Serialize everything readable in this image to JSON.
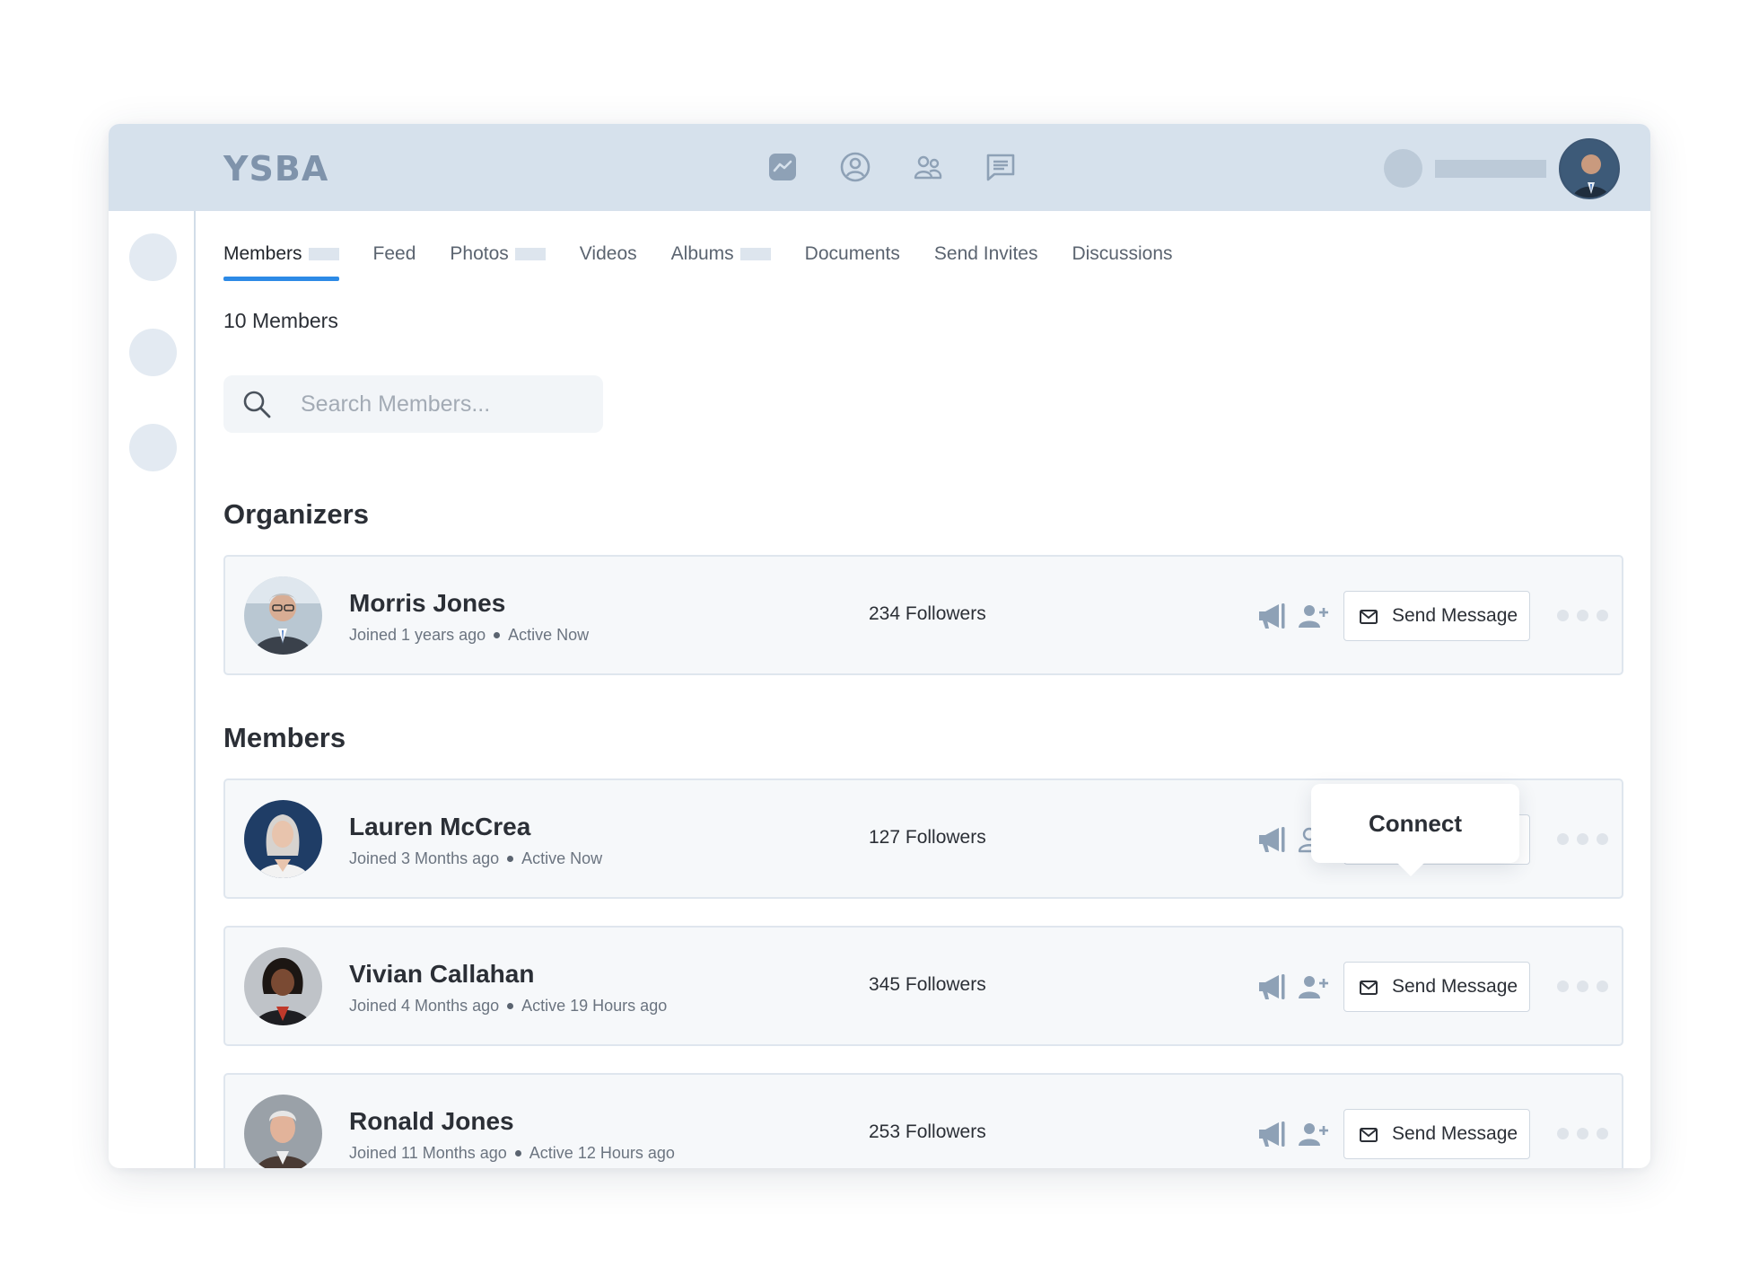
{
  "header": {
    "logo": "YSBA",
    "nav_icons": [
      "activity-icon",
      "profile-icon",
      "groups-icon",
      "messages-icon"
    ]
  },
  "tabs": [
    {
      "label": "Members",
      "active": true
    },
    {
      "label": "Feed"
    },
    {
      "label": "Photos"
    },
    {
      "label": "Videos"
    },
    {
      "label": "Albums"
    },
    {
      "label": "Documents"
    },
    {
      "label": "Send Invites"
    },
    {
      "label": "Discussions"
    }
  ],
  "member_count": "10 Members",
  "search": {
    "placeholder": "Search Members..."
  },
  "sections": {
    "organizers": "Organizers",
    "members": "Members"
  },
  "tooltip": {
    "connect": "Connect"
  },
  "send_message_label": "Send Message",
  "organizers": [
    {
      "name": "Morris Jones",
      "joined": "Joined 1 years ago",
      "activity": "Active Now",
      "followers": "234 Followers"
    }
  ],
  "members": [
    {
      "name": "Lauren McCrea",
      "joined": "Joined 3 Months ago",
      "activity": "Active Now",
      "followers": "127 Followers"
    },
    {
      "name": "Vivian Callahan",
      "joined": "Joined 4 Months ago",
      "activity": "Active 19 Hours ago",
      "followers": "345 Followers"
    },
    {
      "name": "Ronald Jones",
      "joined": "Joined 11 Months ago",
      "activity": "Active 12 Hours ago",
      "followers": "253 Followers"
    }
  ],
  "colors": {
    "accent": "#2d8ae6",
    "header_bg": "#d6e1ec",
    "icon": "#8ea1b6"
  }
}
